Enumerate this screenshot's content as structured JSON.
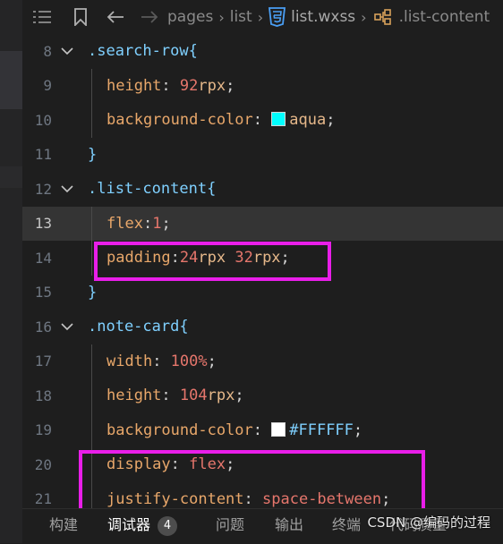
{
  "breadcrumb": {
    "segments": [
      "pages",
      "list"
    ],
    "file": "list.wxss",
    "symbol": ".list-content"
  },
  "editor": {
    "lines": [
      {
        "num": "8",
        "code": [
          [
            ".search-row",
            "sel2"
          ],
          [
            "{",
            "brace"
          ]
        ],
        "indent": 0,
        "fold": true
      },
      {
        "num": "9",
        "code": [
          [
            "height",
            "prop"
          ],
          [
            ": ",
            "colon"
          ],
          [
            "92",
            "num"
          ],
          [
            "rpx",
            "unit"
          ],
          [
            ";",
            "colon"
          ]
        ],
        "indent": 1
      },
      {
        "num": "10",
        "code": [
          [
            "background-color",
            "prop"
          ],
          [
            ": ",
            "colon"
          ],
          [
            "@swatch:aqua",
            "swatch"
          ],
          [
            "aqua",
            "str"
          ],
          [
            ";",
            "colon"
          ]
        ],
        "indent": 1
      },
      {
        "num": "11",
        "code": [
          [
            "}",
            "brace"
          ]
        ],
        "indent": 0
      },
      {
        "num": "12",
        "code": [
          [
            ".list-content",
            "sel2"
          ],
          [
            "{",
            "brace"
          ]
        ],
        "indent": 0,
        "fold": true
      },
      {
        "num": "13",
        "code": [
          [
            "flex",
            "prop"
          ],
          [
            ":",
            "colon"
          ],
          [
            "1",
            "num"
          ],
          [
            ";",
            "colon"
          ]
        ],
        "indent": 1,
        "current": true
      },
      {
        "num": "14",
        "code": [
          [
            "padding",
            "prop"
          ],
          [
            ":",
            "colon"
          ],
          [
            "24",
            "num"
          ],
          [
            "rpx ",
            "unit"
          ],
          [
            "32",
            "num"
          ],
          [
            "rpx",
            "unit"
          ],
          [
            ";",
            "colon"
          ]
        ],
        "indent": 1
      },
      {
        "num": "15",
        "code": [
          [
            "}",
            "brace"
          ]
        ],
        "indent": 0
      },
      {
        "num": "16",
        "code": [
          [
            ".note-card",
            "sel2"
          ],
          [
            "{",
            "brace"
          ]
        ],
        "indent": 0,
        "fold": true
      },
      {
        "num": "17",
        "code": [
          [
            "width",
            "prop"
          ],
          [
            ": ",
            "colon"
          ],
          [
            "100%",
            "num"
          ],
          [
            ";",
            "colon"
          ]
        ],
        "indent": 1
      },
      {
        "num": "18",
        "code": [
          [
            "height",
            "prop"
          ],
          [
            ": ",
            "colon"
          ],
          [
            "104",
            "num"
          ],
          [
            "rpx",
            "unit"
          ],
          [
            ";",
            "colon"
          ]
        ],
        "indent": 1
      },
      {
        "num": "19",
        "code": [
          [
            "background-color",
            "prop"
          ],
          [
            ": ",
            "colon"
          ],
          [
            "@swatch:#FFFFFF",
            "swatch"
          ],
          [
            "#FFFFFF",
            "hex"
          ],
          [
            ";",
            "colon"
          ]
        ],
        "indent": 1
      },
      {
        "num": "20",
        "code": [
          [
            "display",
            "prop"
          ],
          [
            ": ",
            "colon"
          ],
          [
            "flex",
            "kw"
          ],
          [
            ";",
            "colon"
          ]
        ],
        "indent": 1
      },
      {
        "num": "21",
        "code": [
          [
            "justify-content",
            "prop"
          ],
          [
            ": ",
            "colon"
          ],
          [
            "space-between",
            "kw"
          ],
          [
            ";",
            "colon"
          ]
        ],
        "indent": 1
      }
    ]
  },
  "colors": {
    "highlight": "#e91ee9",
    "aqua": "#00ffff",
    "white": "#ffffff"
  },
  "panel": {
    "tabs": [
      "构建",
      "调试器",
      "问题",
      "输出",
      "终端",
      "代码质量"
    ],
    "active": "调试器",
    "debugger_badge": "4"
  },
  "watermark": "CSDN @编码的过程"
}
